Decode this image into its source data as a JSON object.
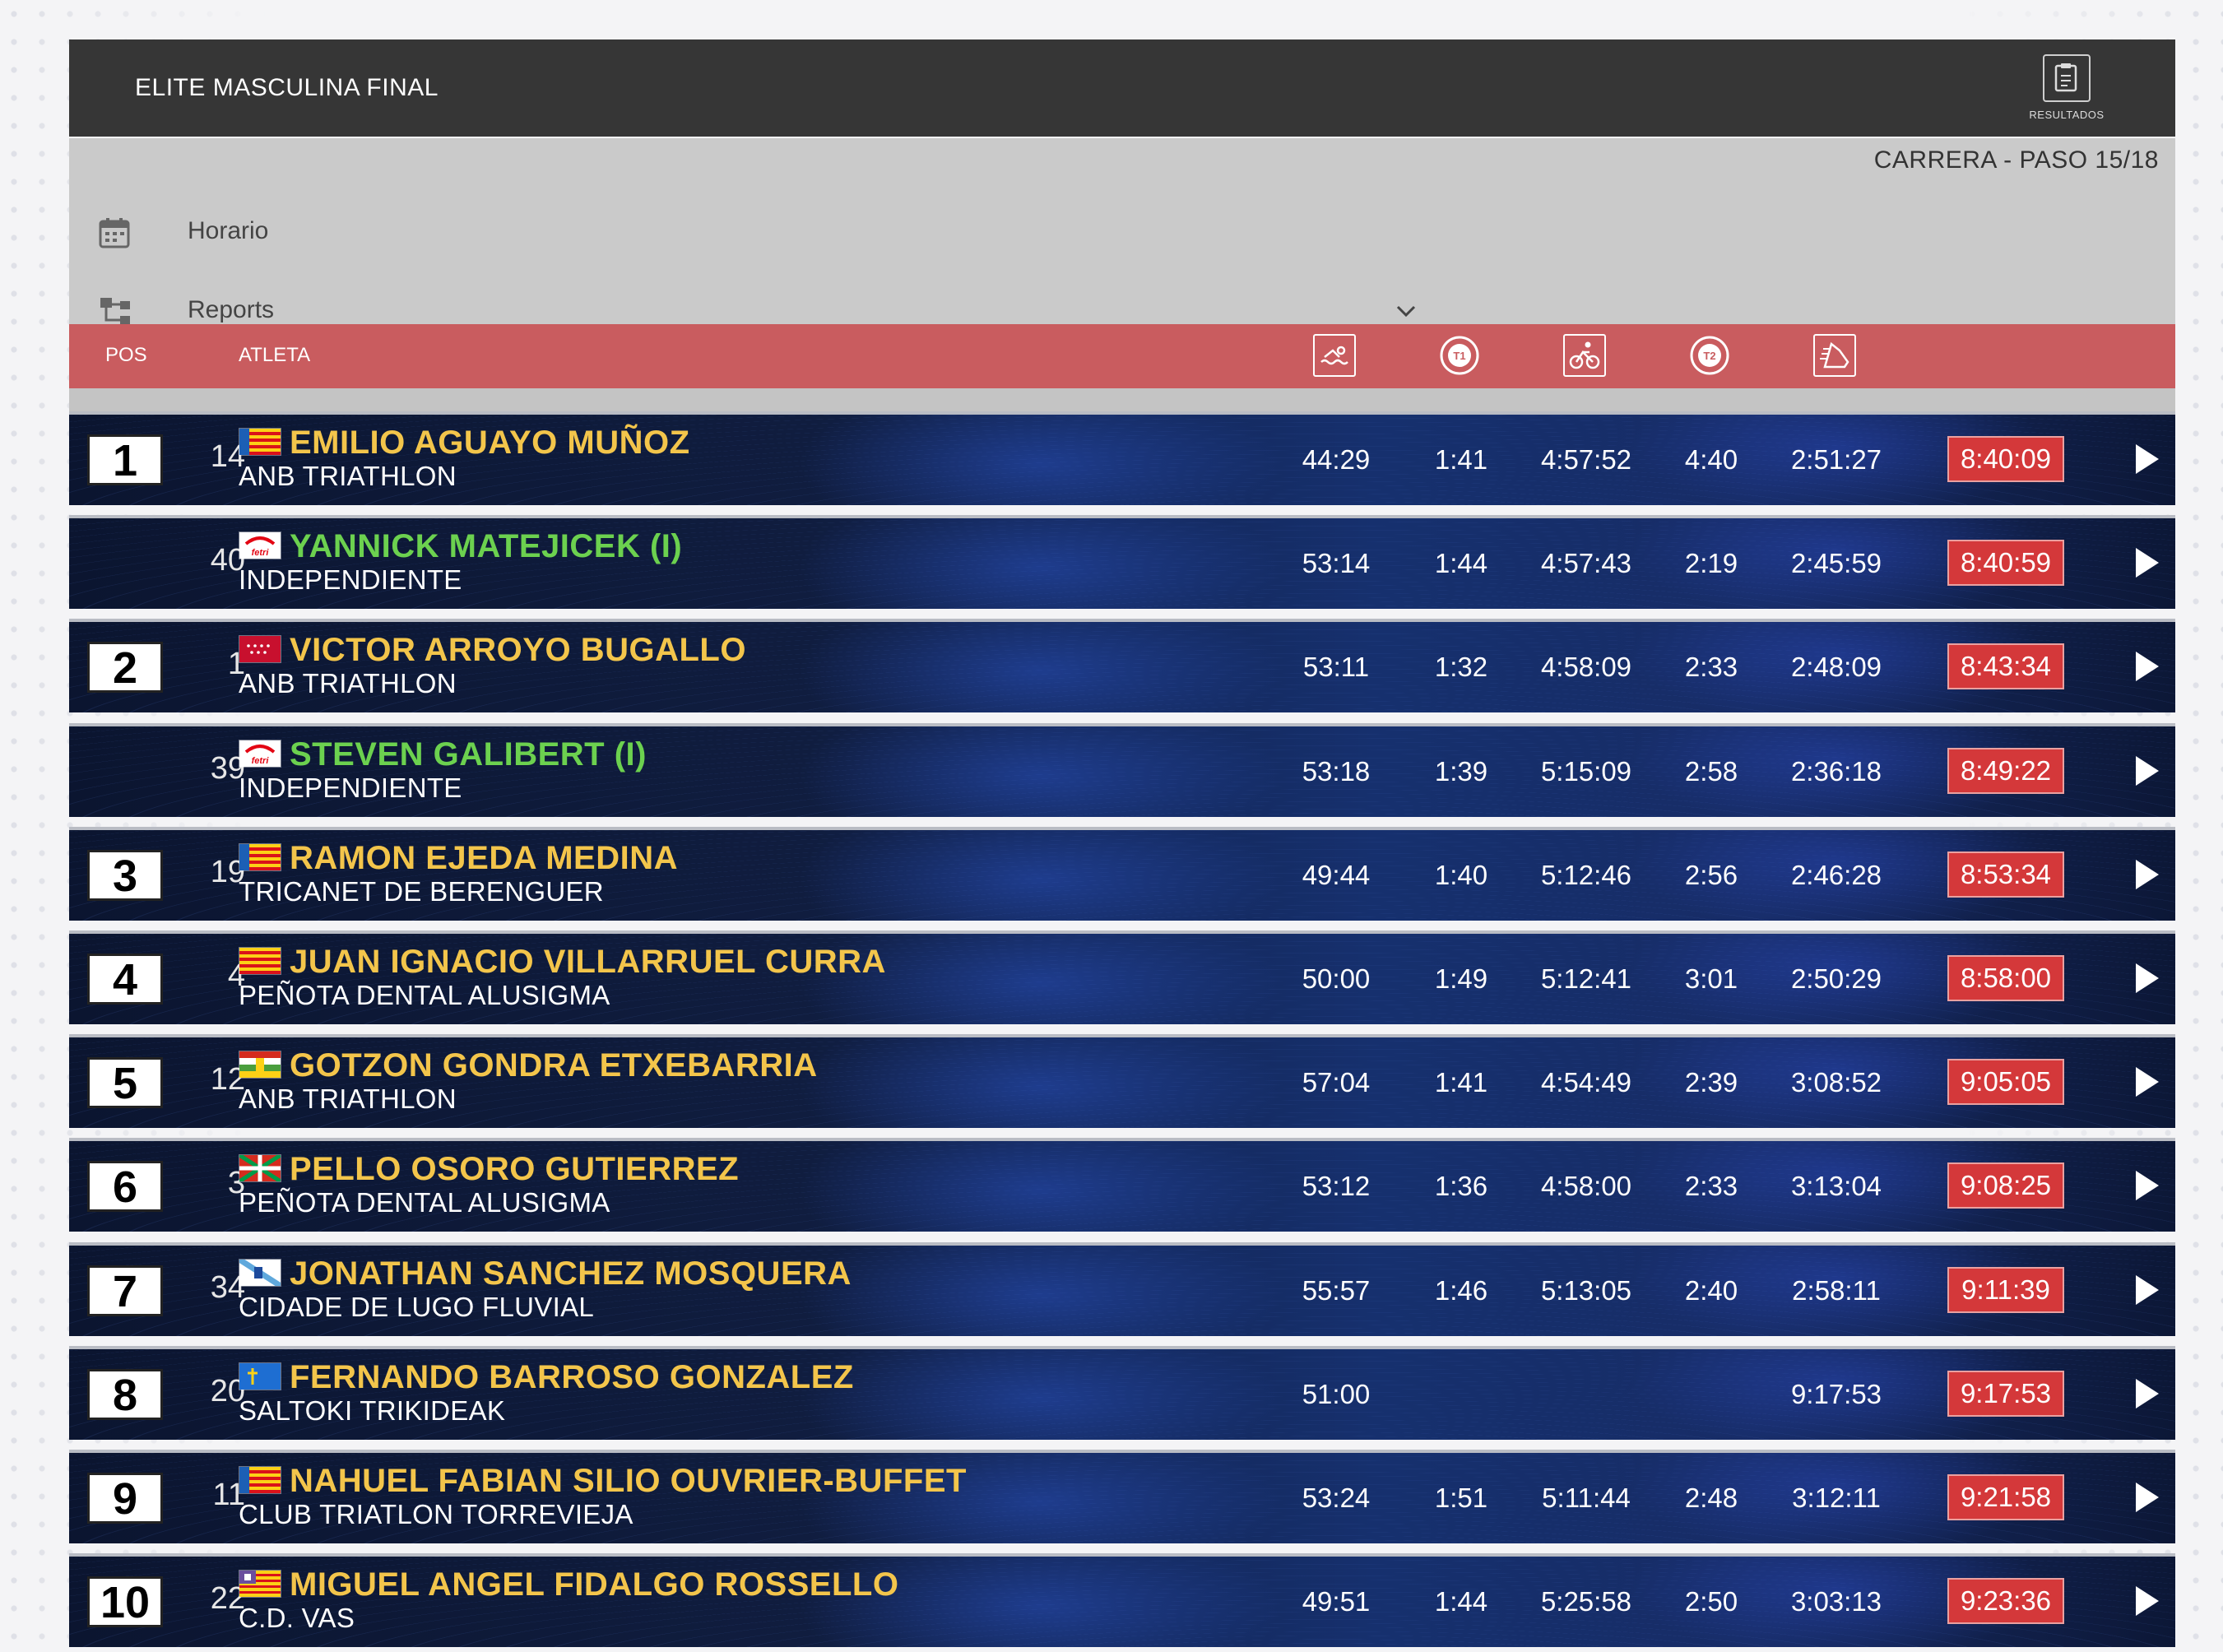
{
  "header": {
    "title": "ELITE MASCULINA FINAL",
    "results_label": "RESULTADOS"
  },
  "menu": {
    "step": "CARRERA - PASO 15/18",
    "items": [
      {
        "label": "Horario",
        "icon": "calendar-icon"
      },
      {
        "label": "Reports",
        "icon": "hierarchy-icon"
      }
    ]
  },
  "columns": {
    "pos": "POS",
    "athlete": "ATLETA",
    "icons": [
      "swim-icon",
      "t1-icon",
      "bike-icon",
      "t2-icon",
      "run-icon"
    ]
  },
  "colors": {
    "header_bg": "#363636",
    "colhead_bg": "#c95c5f",
    "name_color": "#f3c54b",
    "independent_color": "#6cd14f",
    "total_bg": "#d4383a"
  },
  "rows": [
    {
      "pos": "1",
      "bib": "14",
      "flag": "valencia",
      "name": "EMILIO AGUAYO MUÑOZ",
      "club": "ANB TRIATHLON",
      "independent": false,
      "swim": "44:29",
      "t1": "1:41",
      "bike": "4:57:52",
      "t2": "4:40",
      "run": "2:51:27",
      "total": "8:40:09"
    },
    {
      "pos": "",
      "bib": "40",
      "flag": "fetri",
      "name": "YANNICK MATEJICEK (I)",
      "club": "INDEPENDIENTE",
      "independent": true,
      "swim": "53:14",
      "t1": "1:44",
      "bike": "4:57:43",
      "t2": "2:19",
      "run": "2:45:59",
      "total": "8:40:59"
    },
    {
      "pos": "2",
      "bib": "1",
      "flag": "madrid",
      "name": "VICTOR ARROYO BUGALLO",
      "club": "ANB TRIATHLON",
      "independent": false,
      "swim": "53:11",
      "t1": "1:32",
      "bike": "4:58:09",
      "t2": "2:33",
      "run": "2:48:09",
      "total": "8:43:34"
    },
    {
      "pos": "",
      "bib": "39",
      "flag": "fetri",
      "name": "STEVEN GALIBERT (I)",
      "club": "INDEPENDIENTE",
      "independent": true,
      "swim": "53:18",
      "t1": "1:39",
      "bike": "5:15:09",
      "t2": "2:58",
      "run": "2:36:18",
      "total": "8:49:22"
    },
    {
      "pos": "3",
      "bib": "19",
      "flag": "valencia",
      "name": "RAMON EJEDA MEDINA",
      "club": "TRICANET DE BERENGUER",
      "independent": false,
      "swim": "49:44",
      "t1": "1:40",
      "bike": "5:12:46",
      "t2": "2:56",
      "run": "2:46:28",
      "total": "8:53:34"
    },
    {
      "pos": "4",
      "bib": "4",
      "flag": "catalonia",
      "name": "JUAN IGNACIO VILLARRUEL CURRA",
      "club": "PEÑOTA DENTAL ALUSIGMA",
      "independent": false,
      "swim": "50:00",
      "t1": "1:49",
      "bike": "5:12:41",
      "t2": "3:01",
      "run": "2:50:29",
      "total": "8:58:00"
    },
    {
      "pos": "5",
      "bib": "12",
      "flag": "rioja",
      "name": "GOTZON GONDRA ETXEBARRIA",
      "club": "ANB TRIATHLON",
      "independent": false,
      "swim": "57:04",
      "t1": "1:41",
      "bike": "4:54:49",
      "t2": "2:39",
      "run": "3:08:52",
      "total": "9:05:05"
    },
    {
      "pos": "6",
      "bib": "3",
      "flag": "basque",
      "name": "PELLO OSORO GUTIERREZ",
      "club": "PEÑOTA DENTAL ALUSIGMA",
      "independent": false,
      "swim": "53:12",
      "t1": "1:36",
      "bike": "4:58:00",
      "t2": "2:33",
      "run": "3:13:04",
      "total": "9:08:25"
    },
    {
      "pos": "7",
      "bib": "34",
      "flag": "galicia",
      "name": "JONATHAN SANCHEZ MOSQUERA",
      "club": "CIDADE DE LUGO FLUVIAL",
      "independent": false,
      "swim": "55:57",
      "t1": "1:46",
      "bike": "5:13:05",
      "t2": "2:40",
      "run": "2:58:11",
      "total": "9:11:39"
    },
    {
      "pos": "8",
      "bib": "20",
      "flag": "asturias",
      "name": "FERNANDO BARROSO GONZALEZ",
      "club": "SALTOKI TRIKIDEAK",
      "independent": false,
      "swim": "51:00",
      "t1": "",
      "bike": "",
      "t2": "",
      "run": "9:17:53",
      "total": "9:17:53"
    },
    {
      "pos": "9",
      "bib": "11",
      "flag": "valencia",
      "name": "NAHUEL FABIAN SILIO OUVRIER-BUFFET",
      "club": "CLUB TRIATLON TORREVIEJA",
      "independent": false,
      "swim": "53:24",
      "t1": "1:51",
      "bike": "5:11:44",
      "t2": "2:48",
      "run": "3:12:11",
      "total": "9:21:58"
    },
    {
      "pos": "10",
      "bib": "22",
      "flag": "baleares",
      "name": "MIGUEL ANGEL FIDALGO ROSSELLO",
      "club": "C.D. VAS",
      "independent": false,
      "swim": "49:51",
      "t1": "1:44",
      "bike": "5:25:58",
      "t2": "2:50",
      "run": "3:03:13",
      "total": "9:23:36"
    }
  ]
}
